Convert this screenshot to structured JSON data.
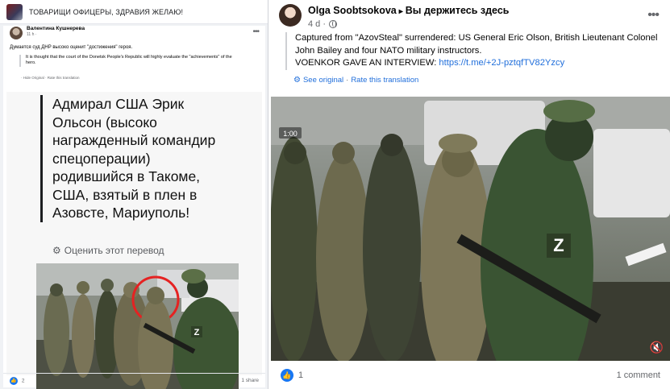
{
  "left_panel": {
    "group_title": "ТОВАРИЩИ ОФИЦЕРЫ, ЗДРАВИЯ ЖЕЛАЮ!",
    "post": {
      "author": "Валентина Кушнерева",
      "meta": "11 h · ",
      "text": "Думается суд ДНР высоко оценит \"достижения\" героя.",
      "translation": "It is thought that the court of the Donetsk People's Republic will highly evaluate the \"achievements\" of the hero.",
      "translation_links": "· Hide Original · Rate this translation",
      "shared_text": "Адмирал США Эрик Ольсон (высоко награжденный командир спецоперации) родившийся в Такоме, США, взятый в плен в Азовсте, Мариуполь!",
      "see_translation": "Оценить этот перевод",
      "likes": "2",
      "shares": "1 share"
    }
  },
  "right_post": {
    "author": "Olga Soobtsokova",
    "arrow": "▸",
    "group": "Вы держитесь здесь",
    "meta": "4 d · ",
    "body_1": "Captured from \"AzovSteal\" surrendered: US General Eric Olson, British Lieutenant Colonel John Bailey and four NATO military instructors.",
    "body_2": "VOENKOR GAVE AN INTERVIEW: ",
    "link": "https://t.me/+2J-pztqfTV82Yzcy",
    "see_original": "See original",
    "rate_translation": "Rate this translation",
    "video_time": "1:00",
    "likes": "1",
    "comments": "1 comment"
  },
  "icons": {
    "more": "more-options-icon",
    "globe": "globe-icon",
    "gear": "gear-icon",
    "like": "like-icon",
    "speaker": "speaker-icon"
  },
  "colors": {
    "accent": "#1877f2",
    "link": "#216fdb",
    "muted": "#65676b"
  }
}
